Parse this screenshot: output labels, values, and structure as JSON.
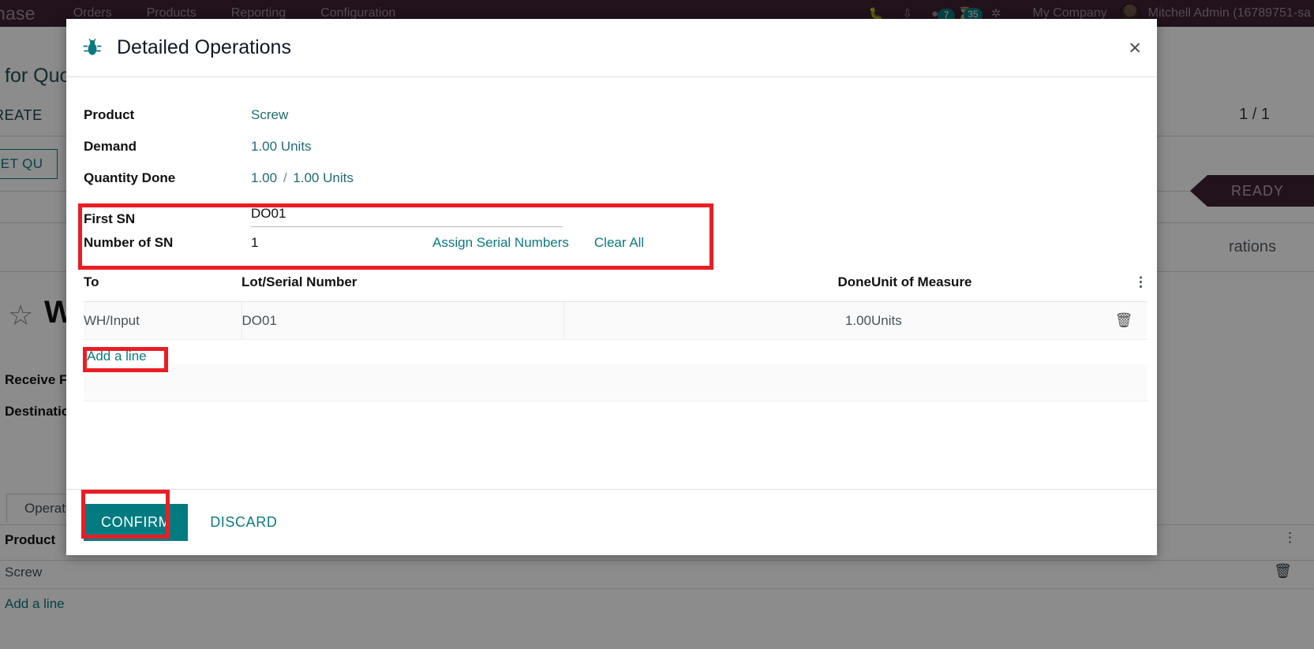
{
  "navbar": {
    "brand": "hase",
    "menus": [
      "Orders",
      "Products",
      "Reporting",
      "Configuration"
    ],
    "icons": [
      "bug-icon",
      "upload-icon",
      "messages-icon",
      "activities-icon",
      "debug-icon"
    ],
    "badges": {
      "messages": "7",
      "activities": "35"
    },
    "company": "My Company",
    "user": "Mitchell Admin (16789751-sa"
  },
  "background": {
    "breadcrumb": "for Quo",
    "create_button": "REATE",
    "set_quantities_button": "SET QU",
    "pager": "1 / 1",
    "status_ribbon": "READY",
    "smart_button": "rations",
    "record_title": "W",
    "field_labels": [
      "Receive F",
      "Destinatio"
    ],
    "tab": "Operatio",
    "table_header": "Product",
    "table_cell": "Screw",
    "add_line": "Add a line",
    "star_icon": "☆",
    "trash_icon": "trash-icon",
    "dots_icon": "vertical-dots-icon"
  },
  "modal": {
    "icon": "bug-icon",
    "title": "Detailed Operations",
    "close_label": "×",
    "fields": [
      {
        "label": "Product",
        "value": "Screw",
        "unit": "",
        "type": "link"
      },
      {
        "label": "Demand",
        "value": "1.00",
        "unit": "Units",
        "type": "readonly"
      },
      {
        "label": "Quantity Done",
        "value": "1.00",
        "value2": "1.00",
        "separator": "/",
        "unit": "Units",
        "type": "readonly"
      }
    ],
    "serial": {
      "first_sn_label": "First SN",
      "first_sn_value": "DO01",
      "number_label": "Number of SN",
      "number_value": "1",
      "assign_button": "Assign Serial Numbers",
      "clear_button": "Clear All"
    },
    "table": {
      "columns": [
        "To",
        "Lot/Serial Number",
        "Done",
        "Unit of Measure"
      ],
      "optional_columns_icon": "vertical-dots-icon",
      "rows": [
        {
          "to": "WH/Input",
          "lot_serial": "DO01",
          "done": "1.00",
          "uom": "Units",
          "delete_icon": "trash-icon"
        }
      ],
      "add_line": "Add a line"
    },
    "footer": {
      "confirm": "CONFIRM",
      "discard": "DISCARD"
    }
  },
  "annotations": {
    "boxes": [
      "serial-number-section",
      "add-a-line-link",
      "confirm-button"
    ],
    "color": "#ea1d25"
  },
  "colors": {
    "accent_teal": "#0b7a7f",
    "button_teal": "#017b80",
    "navbar_purple": "#3c2233",
    "highlight_red": "#ea1d25"
  }
}
